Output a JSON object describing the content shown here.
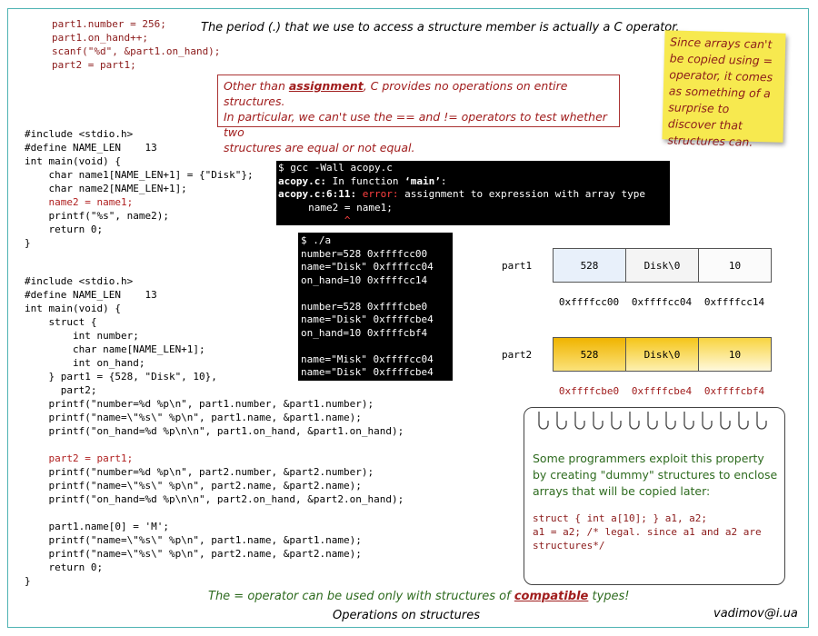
{
  "snippet_top": {
    "line1": "part1.number = 256;",
    "line2": "part1.on_hand++;",
    "line3": "scanf(\"%d\", &part1.on_hand);",
    "line4": "part2 = part1;"
  },
  "notes": {
    "period_note": "The period (.) that we use to access a structure member is actually a C operator.",
    "assign_pre": "Other than ",
    "assign_word": "assignment",
    "assign_post": ", C provides no operations on entire structures.",
    "assign_line2": "In particular, we can't use the == and != operators to test whether two",
    "assign_line3": "structures are equal or not equal.",
    "sticky": "Since arrays can't be copied using = operator, it comes as something of a surprise to discover that structures can.",
    "bottom_pre": "The = operator can be used only with structures of ",
    "bottom_word": "compatible",
    "bottom_post": " types!",
    "footer_title": "Operations on structures",
    "footer_email": "vadimov@i.ua"
  },
  "program1": {
    "l1": "#include <stdio.h>",
    "l2": "#define NAME_LEN    13",
    "l3": "int main(void) {",
    "l4": "    char name1[NAME_LEN+1] = {\"Disk\"};",
    "l5": "    char name2[NAME_LEN+1];",
    "l6": "    name2 = name1;",
    "l7": "    printf(\"%s\", name2);",
    "l8": "    return 0;",
    "l9": "}"
  },
  "compile_terminal": {
    "l1": "$ gcc -Wall acopy.c",
    "l2a": "acopy.c:",
    "l2b": " In function ",
    "l2c": "‘main’",
    "l2d": ":",
    "l3a": "acopy.c:6:11:",
    "l3b": " error:",
    "l3c": " assignment to expression with array type",
    "l4": "     name2 = name1;",
    "l5": "           ^"
  },
  "run_terminal": {
    "l1": "$ ./a",
    "l2": "number=528 0xffffcc00",
    "l3": "name=\"Disk\" 0xffffcc04",
    "l4": "on_hand=10 0xffffcc14",
    "l5": "number=528 0xffffcbe0",
    "l6": "name=\"Disk\" 0xffffcbe4",
    "l7": "on_hand=10 0xffffcbf4",
    "l8": "name=\"Misk\" 0xffffcc04",
    "l9": "name=\"Disk\" 0xffffcbe4"
  },
  "program2": {
    "l1": "#include <stdio.h>",
    "l2": "#define NAME_LEN    13",
    "l3": "int main(void) {",
    "l4": "    struct {",
    "l5": "        int number;",
    "l6": "        char name[NAME_LEN+1];",
    "l7": "        int on_hand;",
    "l8": "    } part1 = {528, \"Disk\", 10},",
    "l9": "      part2;",
    "l10": "    printf(\"number=%d %p\\n\", part1.number, &part1.number);",
    "l11": "    printf(\"name=\\\"%s\\\" %p\\n\", part1.name, &part1.name);",
    "l12": "    printf(\"on_hand=%d %p\\n\\n\", part1.on_hand, &part1.on_hand);",
    "l13": "    part2 = part1;",
    "l14": "    printf(\"number=%d %p\\n\", part2.number, &part2.number);",
    "l15": "    printf(\"name=\\\"%s\\\" %p\\n\", part2.name, &part2.name);",
    "l16": "    printf(\"on_hand=%d %p\\n\\n\", part2.on_hand, &part2.on_hand);",
    "l17": "    part1.name[0] = 'M';",
    "l18": "    printf(\"name=\\\"%s\\\" %p\\n\", part1.name, &part1.name);",
    "l19": "    printf(\"name=\\\"%s\\\" %p\\n\", part2.name, &part2.name);",
    "l20": "    return 0;",
    "l21": "}"
  },
  "memory": {
    "part1": {
      "label": "part1",
      "cells": [
        "528",
        "Disk\\0",
        "10"
      ],
      "addrs": [
        "0xffffcc00",
        "0xffffcc04",
        "0xffffcc14"
      ],
      "fill": "#e8f0fa"
    },
    "part2": {
      "label": "part2",
      "cells": [
        "528",
        "Disk\\0",
        "10"
      ],
      "addrs": [
        "0xffffcbe0",
        "0xffffcbe4",
        "0xffffcbf4"
      ],
      "fill": "#f5c518"
    }
  },
  "notebook": {
    "text": "Some programmers exploit this property by creating \"dummy\" structures to enclose arrays that will be copied later:",
    "code1": "struct { int a[10]; } a1, a2;",
    "code2": "a1 = a2; /* legal. since a1 and a2 are",
    "code3": "structures*/"
  },
  "colors": {
    "frame": "#4fb3b3",
    "dark_red": "#8b1a1a",
    "green_text": "#2e6b1f",
    "sticky": "#f7e94f"
  }
}
